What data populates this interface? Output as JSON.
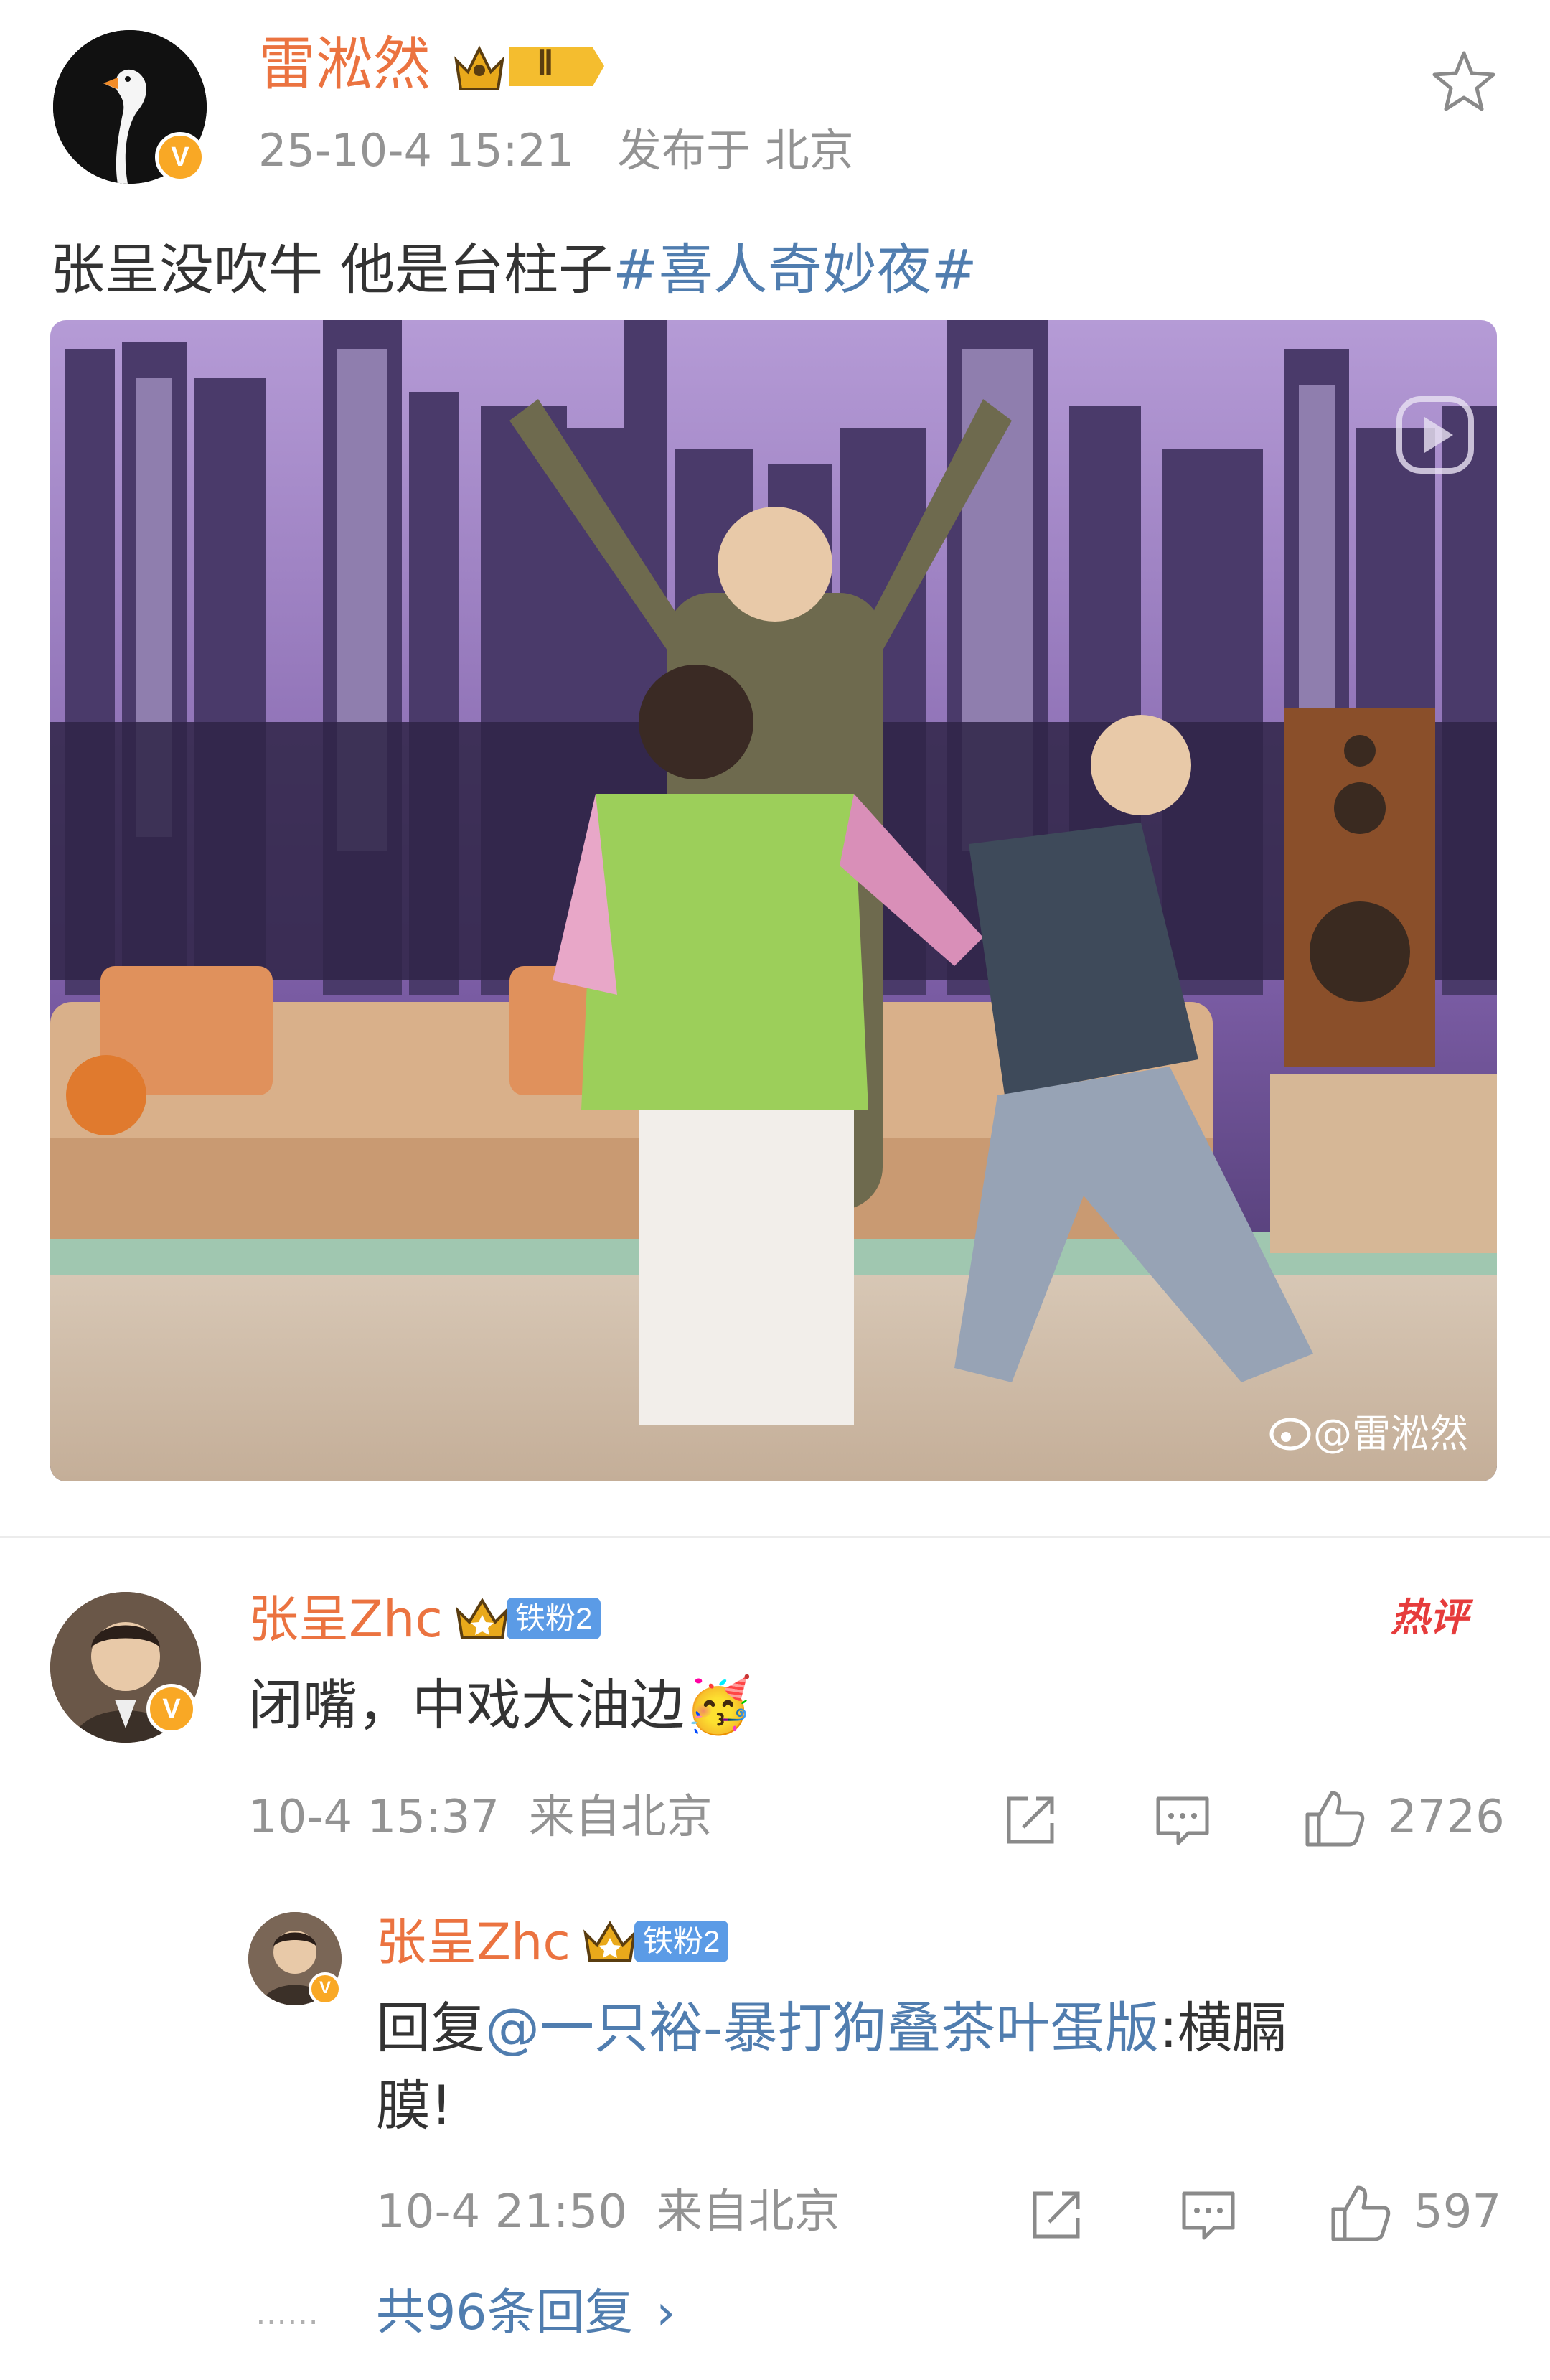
{
  "post": {
    "author": "雷淞然",
    "level_badge": "Ⅱ",
    "timestamp": "25-10-4 15:21",
    "location": "发布于 北京",
    "text_prefix": "张呈没吹牛 他是台柱子",
    "hashtag": "#喜人奇妙夜#",
    "watermark": "@雷淞然",
    "icons": [
      "star-icon",
      "weibo-logo-icon",
      "video-play-icon"
    ]
  },
  "comment": {
    "author": "张呈Zhc",
    "fan_badge": "铁粉2",
    "hot_tag": "热评",
    "text": "闭嘴，中戏大油边",
    "emoji": "🥳",
    "timestamp": "10-4 15:37",
    "location": "来自北京",
    "likes": "2726",
    "icons": [
      "share-icon",
      "comment-icon",
      "like-icon"
    ]
  },
  "reply": {
    "author": "张呈Zhc",
    "fan_badge": "铁粉2",
    "prefix": "回复",
    "mention": "@一只裕-暴打狗叠茶叶蛋版",
    "text_line1": ":横膈",
    "text_line2": "膜!",
    "timestamp": "10-4 21:50",
    "location": "来自北京",
    "likes": "597"
  },
  "more_replies": {
    "dots": "……",
    "label": "共96条回复",
    "chevron": "›"
  },
  "colors": {
    "name_orange": "#eb7340",
    "link_blue": "#507daf",
    "verified_gold": "#f9a825",
    "fan_badge_blue": "#5b9be6",
    "meta_gray": "#939393"
  }
}
